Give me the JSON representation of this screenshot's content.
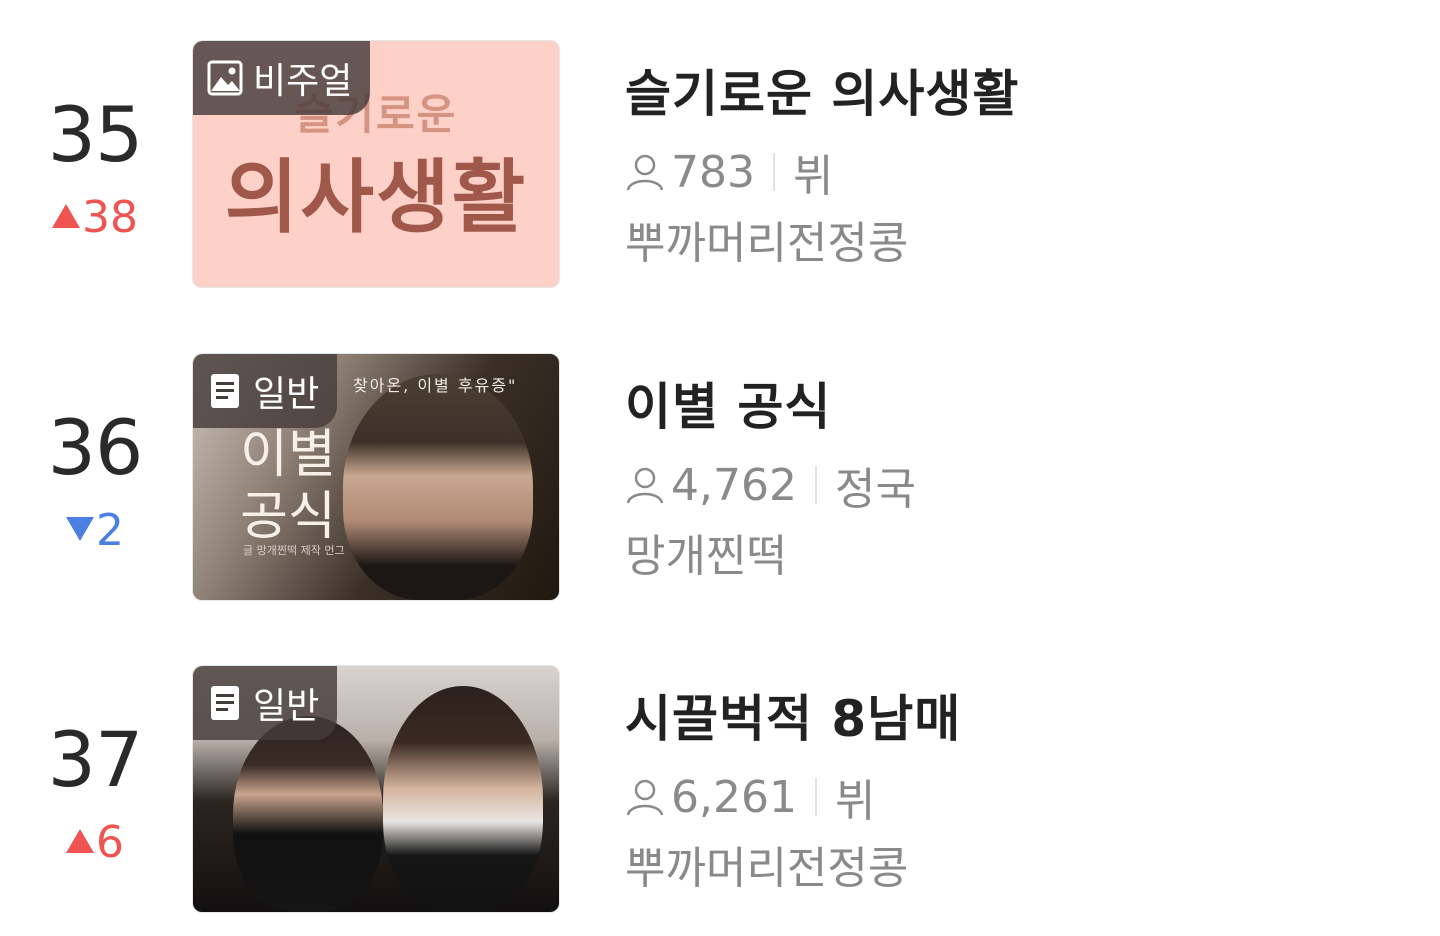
{
  "items": [
    {
      "rank": "35",
      "change": "38",
      "change_direction": "up",
      "badge": "비주얼",
      "badge_icon": "image-icon",
      "title": "슬기로운 의사생활",
      "views": "783",
      "category": "뷔",
      "author": "뿌까머리전정콩",
      "thumb_text_top": "슬기로운",
      "thumb_text_main": "의사생활"
    },
    {
      "rank": "36",
      "change": "2",
      "change_direction": "down",
      "badge": "일반",
      "badge_icon": "document-icon",
      "title": "이별 공식",
      "views": "4,762",
      "category": "정국",
      "author": "망개찐떡",
      "thumb_caption": "찾아온, 이별 후유증\"",
      "thumb_vertical_title": "이별 공식",
      "thumb_credit": "글 망개찐떡 제작 먼그"
    },
    {
      "rank": "37",
      "change": "6",
      "change_direction": "up",
      "badge": "일반",
      "badge_icon": "document-icon",
      "title": "시끌벅적 8남매",
      "views": "6,261",
      "category": "뷔",
      "author": "뿌까머리전정콩"
    }
  ],
  "colors": {
    "rank_text": "#2a2a2a",
    "change_up": "#f05450",
    "change_down": "#4d7fe3",
    "meta_text": "#8a8a8a",
    "badge_bg": "#463c3a"
  }
}
